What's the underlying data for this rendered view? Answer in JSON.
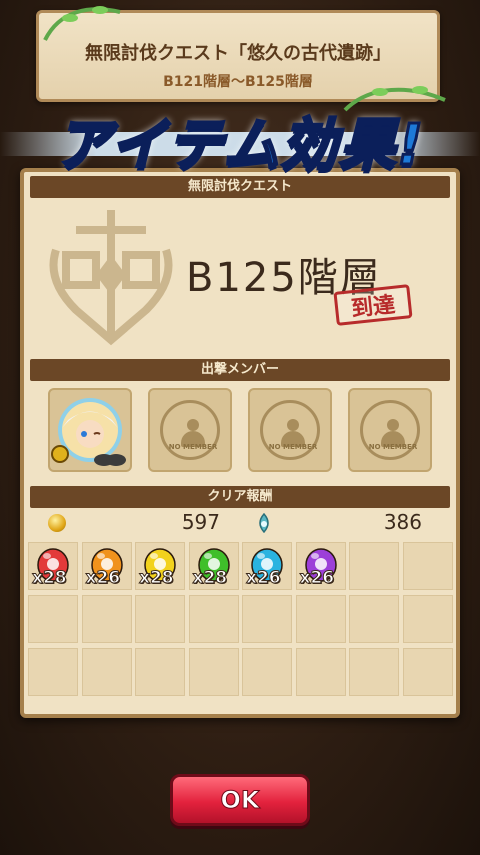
{
  "header": {
    "title": "無限討伐クエスト「悠久の古代遺跡」",
    "subtitle": "B121階層～B125階層"
  },
  "banner": {
    "text": "アイテム効果!"
  },
  "quest_section": {
    "label": "無限討伐クエスト",
    "floor": "B125階層",
    "stamp": "到達"
  },
  "members_section": {
    "label": "出撃メンバー",
    "empty_label": "NO MEMBER"
  },
  "rewards_section": {
    "label": "クリア報酬",
    "gold": "597",
    "exp": "386",
    "items": [
      {
        "color": "#e23a3a",
        "count": "x28"
      },
      {
        "color": "#f0921c",
        "count": "x26"
      },
      {
        "color": "#f2d21c",
        "count": "x28"
      },
      {
        "color": "#3fbf2a",
        "count": "x28"
      },
      {
        "color": "#2ab3e0",
        "count": "x26"
      },
      {
        "color": "#9c3fd8",
        "count": "x26"
      }
    ]
  },
  "ok_button": {
    "label": "OK"
  }
}
